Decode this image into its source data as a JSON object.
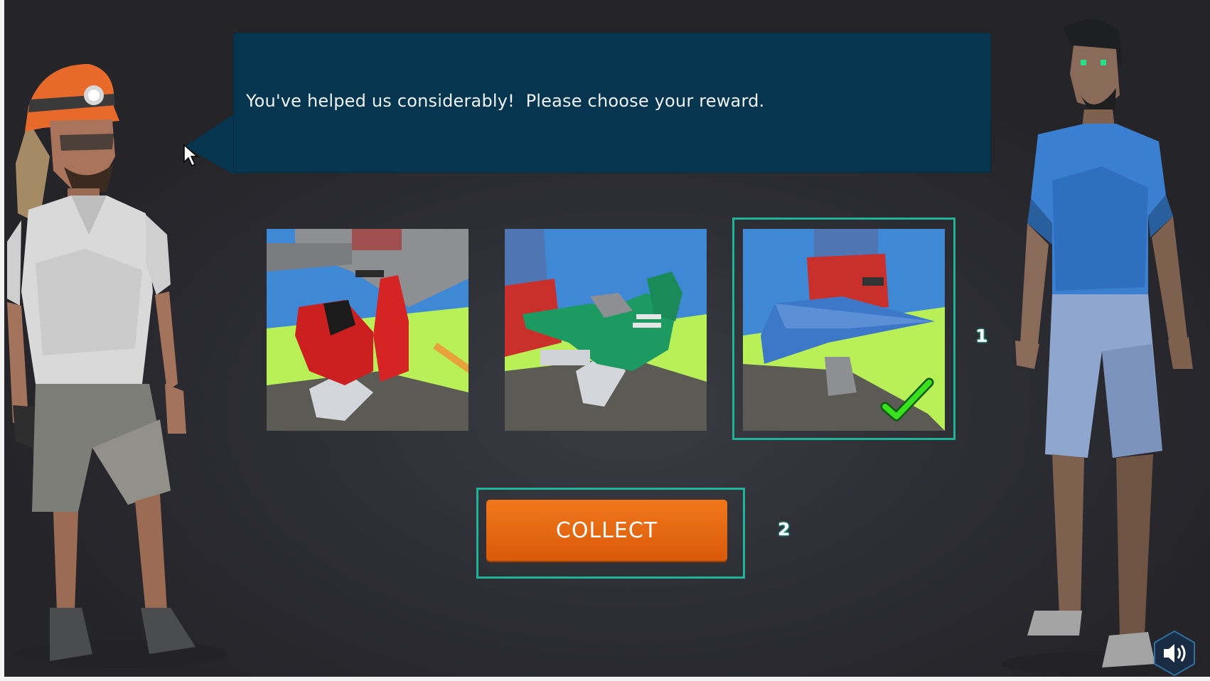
{
  "dialog": {
    "message": "You've helped us considerably!  Please choose your reward."
  },
  "rewards": [
    {
      "name": "Red scooter",
      "selected": false
    },
    {
      "name": "Green motorcycle",
      "selected": false
    },
    {
      "name": "Blue paper airplane",
      "selected": true
    }
  ],
  "collect_button": {
    "label": "COLLECT"
  },
  "markers": {
    "selection_step": "1",
    "collect_step": "2"
  },
  "icons": {
    "checkmark": "checkmark-icon",
    "sound": "speaker-icon",
    "cursor": "mouse-pointer-icon"
  },
  "colors": {
    "bubble": "#05354f",
    "highlight": "#1fb39a",
    "collect_button": "#e8690f",
    "check": "#39e01e"
  }
}
